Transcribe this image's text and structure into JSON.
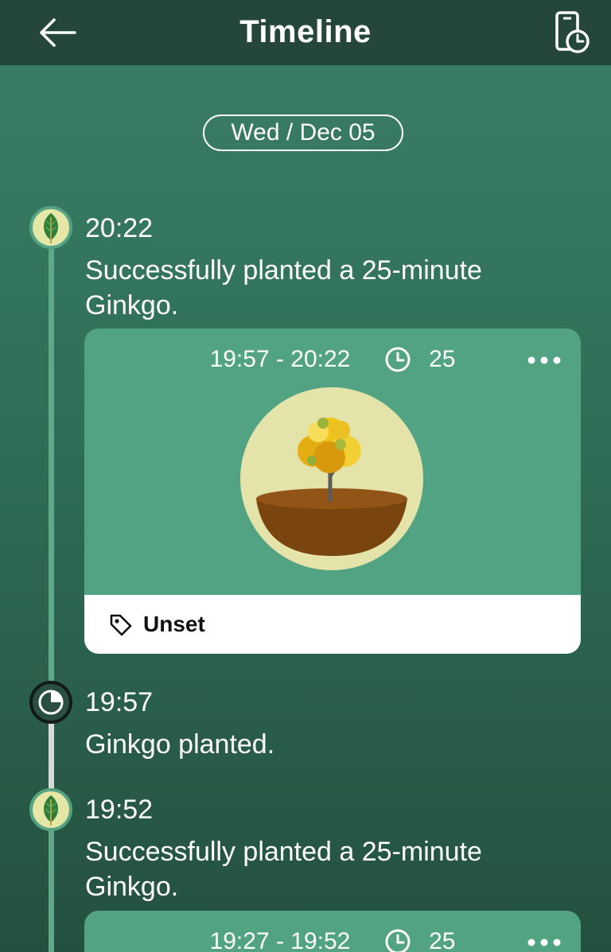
{
  "header": {
    "title": "Timeline",
    "back_icon": "arrow-left-icon",
    "right_icon": "phone-clock-icon"
  },
  "date_label": "Wed / Dec 05",
  "entries": [
    {
      "node_icon": "leaf-icon",
      "time": "20:22",
      "description": "Successfully planted a 25-minute Ginkgo.",
      "card": {
        "range": "19:57 - 20:22",
        "duration": "25",
        "tag": "Unset"
      }
    },
    {
      "node_icon": "clock-icon",
      "time": "19:57",
      "description": "Ginkgo planted."
    },
    {
      "node_icon": "leaf-icon",
      "time": "19:52",
      "description": "Successfully planted a 25-minute Ginkgo.",
      "card": {
        "range": "19:27 - 19:52",
        "duration": "25"
      }
    }
  ],
  "colors": {
    "header_bg": "#25473a",
    "card_bg": "#52a384",
    "timeline_green": "#5ea988",
    "timeline_grey": "#d9d9d9",
    "tree_circle": "#e4e3a9",
    "soil": "#7a440e"
  }
}
